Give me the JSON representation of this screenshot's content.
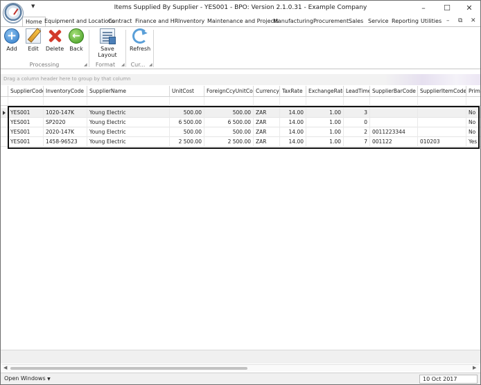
{
  "window": {
    "title": "Items Supplied By Supplier - YES001 - BPO: Version 2.1.0.31 - Example Company",
    "controls": [
      "–",
      "☐",
      "✕"
    ]
  },
  "tabs": [
    "Home",
    "Equipment and Locations",
    "Contract",
    "Finance and HR",
    "Inventory",
    "Maintenance and Projects",
    "Manufacturing",
    "Procurement",
    "Sales",
    "Service",
    "Reporting",
    "Utilities"
  ],
  "tab_controls": [
    "–",
    "⧉",
    "✕"
  ],
  "ribbon": {
    "buttons": [
      {
        "label": "Add",
        "icon": "add-icon"
      },
      {
        "label": "Edit",
        "icon": "edit-icon"
      },
      {
        "label": "Delete",
        "icon": "delete-icon"
      },
      {
        "label": "Back",
        "icon": "back-icon"
      },
      {
        "label": "Save Layout",
        "icon": "save-layout-icon"
      },
      {
        "label": "Refresh",
        "icon": "refresh-icon"
      }
    ],
    "groups": [
      "Processing",
      "Format",
      "Cur..."
    ]
  },
  "group_panel": {
    "placeholder": "Drag a column header here to group by that column"
  },
  "grid": {
    "columns": [
      "SupplierCode",
      "InventoryCode",
      "SupplierName",
      "UnitCost",
      "ForeignCcyUnitCost",
      "Currency",
      "TaxRate",
      "ExchangeRate",
      "LeadTime",
      "SupplierBarCode",
      "SupplierItemCode",
      "Prima"
    ],
    "rows": [
      [
        "YES001",
        "1020-147K",
        "Young Electric",
        "500.00",
        "500.00",
        "ZAR",
        "14.00",
        "1.00",
        "3",
        "",
        "",
        "No"
      ],
      [
        "YES001",
        "SP2020",
        "Young Electric",
        "6 500.00",
        "6 500.00",
        "ZAR",
        "14.00",
        "1.00",
        "0",
        "",
        "",
        "No"
      ],
      [
        "YES001",
        "2020-147K",
        "Young Electric",
        "500.00",
        "500.00",
        "ZAR",
        "14.00",
        "1.00",
        "2",
        "0011223344",
        "",
        "No"
      ],
      [
        "YES001",
        "1458-96523",
        "Young Electric",
        "2 500.00",
        "2 500.00",
        "ZAR",
        "14.00",
        "1.00",
        "7",
        "001122",
        "010203",
        "Yes"
      ]
    ]
  },
  "statusbar": {
    "open_windows": "Open Windows",
    "date": "10 Oct 2017"
  }
}
